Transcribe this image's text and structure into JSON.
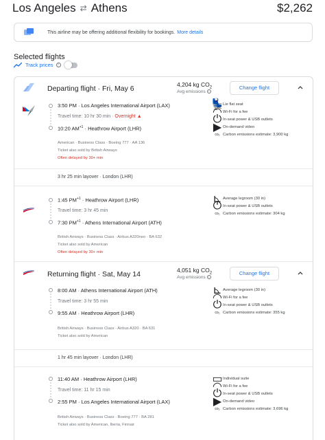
{
  "header": {
    "origin": "Los Angeles",
    "destination": "Athens",
    "price": "$2,262"
  },
  "notice": {
    "text": "This airline may be offering additional flexibility for bookings.",
    "link": "More details"
  },
  "selected": {
    "title": "Selected flights",
    "track_label": "Track prices",
    "track_enabled": false
  },
  "departing": {
    "title": "Departing flight · Fri, May 6",
    "co2": "4,204 kg CO",
    "co2_sub": "2",
    "avg": "Avg emissions",
    "change_label": "Change flight",
    "seg1": {
      "dep_time": "3:50 PM",
      "dep_airport": "Los Angeles International Airport (LAX)",
      "travel": "Travel time: 10 hr 30 min",
      "overnight": "Overnight",
      "arr_time": "10:20 AM",
      "arr_sup": "+1",
      "arr_airport": "Heathrow Airport (LHR)",
      "meta1": "American · Business Class · Boeing 777 · AA 136",
      "meta2": "Ticket also sold by British Airways",
      "delay": "Often delayed by 30+ min",
      "amenities": [
        "Lie flat seat",
        "Wi-Fi for a fee",
        "In-seat power & USB outlets",
        "On-demand video",
        "Carbon emissions estimate: 3,900 kg"
      ]
    },
    "layover": "3 hr 25 min layover · London (LHR)",
    "seg2": {
      "dep_time": "1:45 PM",
      "dep_sup": "+1",
      "dep_airport": "Heathrow Airport (LHR)",
      "travel": "Travel time: 3 hr 45 min",
      "arr_time": "7:30 PM",
      "arr_sup": "+1",
      "arr_airport": "Athens International Airport (ATH)",
      "meta1": "British Airways · Business Class · Airbus A320neo · BA 632",
      "meta2": "Ticket also sold by American",
      "delay": "Often delayed by 30+ min",
      "amenities": [
        "Average legroom (30 in)",
        "In-seat power & USB outlets",
        "Carbon emissions estimate: 304 kg"
      ]
    }
  },
  "returning": {
    "title": "Returning flight · Sat, May 14",
    "co2": "4,051 kg CO",
    "co2_sub": "2",
    "avg": "Avg emissions",
    "change_label": "Change flight",
    "seg1": {
      "dep_time": "8:00 AM",
      "dep_airport": "Athens International Airport (ATH)",
      "travel": "Travel time: 3 hr 55 min",
      "arr_time": "9:55 AM",
      "arr_airport": "Heathrow Airport (LHR)",
      "meta1": "British Airways · Business Class · Airbus A320 · BA 631",
      "meta2": "Ticket also sold by American",
      "amenities": [
        "Average legroom (30 in)",
        "Wi-Fi for a fee",
        "In-seat power & USB outlets",
        "Carbon emissions estimate: 355 kg"
      ]
    },
    "layover": "1 hr 45 min layover · London (LHR)",
    "seg2": {
      "dep_time": "11:40 AM",
      "dep_airport": "Heathrow Airport (LHR)",
      "travel": "Travel time: 11 hr 15 min",
      "arr_time": "2:55 PM",
      "arr_airport": "Los Angeles International Airport (LAX)",
      "meta1": "British Airways · Business Class · Boeing 777 · BA 281",
      "meta2": "Ticket also sold by American, Iberia, Finnair",
      "amenities": [
        "Individual suite",
        "Wi-Fi for a fee",
        "In-seat power & USB outlets",
        "On-demand video",
        "Carbon emissions estimate: 3,696 kg"
      ]
    }
  },
  "colors": {
    "accent": "#1a73e8",
    "warning": "#d93025",
    "muted": "#70757a",
    "border": "#dadce0"
  }
}
